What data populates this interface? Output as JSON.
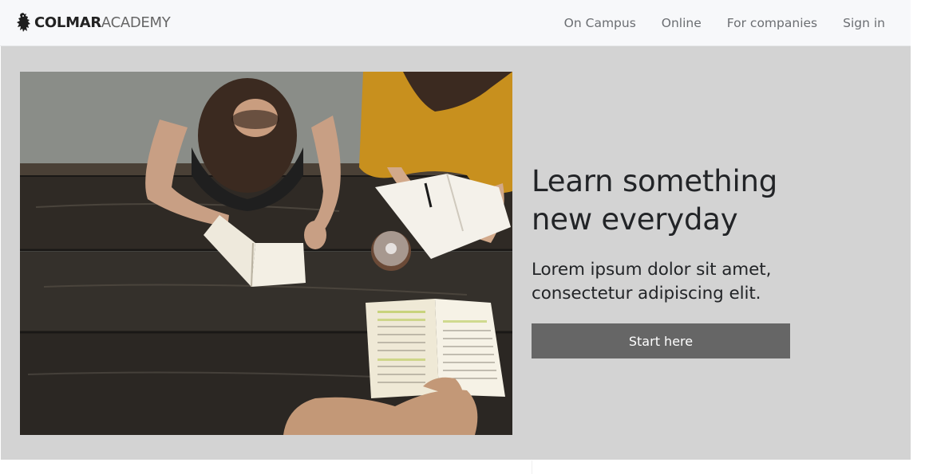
{
  "navbar": {
    "brand_strong": "COLMAR",
    "brand_light": "ACADEMY",
    "logo_icon": "lion-rampant-icon",
    "links": [
      {
        "label": "On Campus"
      },
      {
        "label": "Online"
      },
      {
        "label": "For companies"
      },
      {
        "label": "Sign in"
      }
    ]
  },
  "hero": {
    "image_icon": "students-studying-photo",
    "title_line1": "Learn something",
    "title_line2": "new everyday",
    "subtitle_line1": "Lorem ipsum dolor sit amet,",
    "subtitle_line2": "consectetur adipiscing elit.",
    "button_label": "Start here"
  },
  "colors": {
    "navbar_bg": "#f7f8fa",
    "hero_bg": "#d3d3d3",
    "button_bg": "#666666",
    "text_dark": "#222427",
    "nav_text": "#6b6e72"
  }
}
